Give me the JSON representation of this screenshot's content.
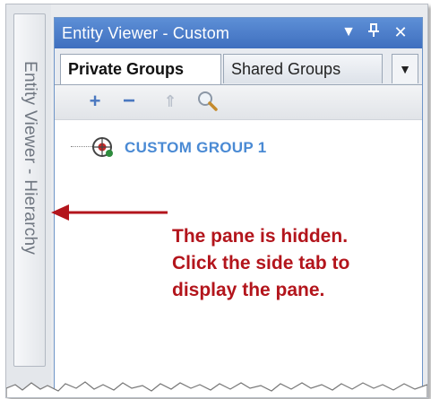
{
  "side_tab": {
    "label": "Entity Viewer - Hierarchy"
  },
  "pane": {
    "title": "Entity Viewer - Custom",
    "title_buttons": {
      "dropdown": "▼",
      "pin": "ᵻ",
      "close": "✕"
    },
    "tabs": [
      {
        "label": "Private Groups",
        "active": true
      },
      {
        "label": "Shared Groups",
        "active": false
      }
    ],
    "tab_overflow": "▼",
    "toolbar": {
      "add": "+",
      "remove": "−",
      "move_up": "⇑",
      "search_icon": "magnifier-icon"
    },
    "tree": [
      {
        "label": "CUSTOM GROUP 1",
        "icon": "group-icon"
      }
    ]
  },
  "annotation": {
    "lines": [
      "The pane is hidden.",
      "Click the side tab to",
      "display the pane."
    ],
    "color": "#b3151c"
  },
  "colors": {
    "title_bar": "#4f80cc",
    "group_label": "#4a8ad4"
  }
}
